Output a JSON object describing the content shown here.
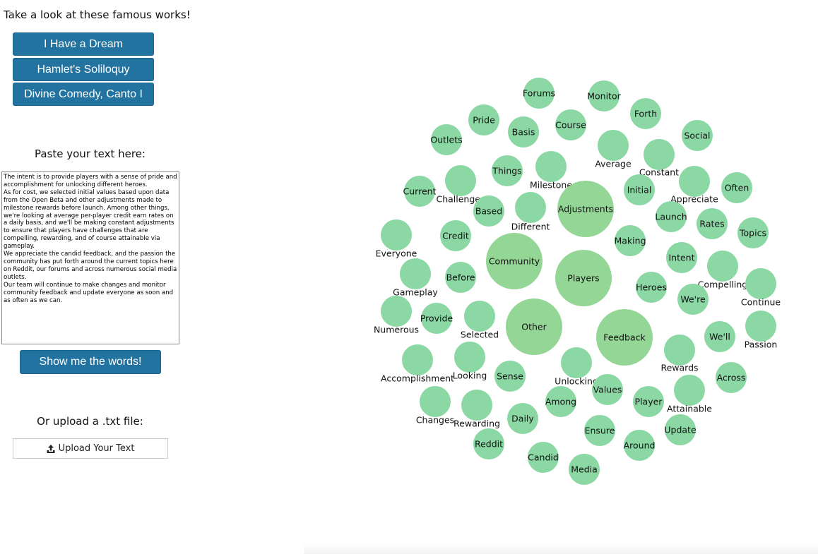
{
  "header": {
    "title": "Take a look at these famous works!"
  },
  "works": [
    {
      "label": "I Have a Dream"
    },
    {
      "label": "Hamlet's Soliloquy"
    },
    {
      "label": "Divine Comedy, Canto I"
    }
  ],
  "paste": {
    "label": "Paste your text here:",
    "text": "The intent is to provide players with a sense of pride and accomplishment for unlocking different heroes.\nAs for cost, we selected initial values based upon data from the Open Beta and other adjustments made to milestone rewards before launch. Among other things, we're looking at average per-player credit earn rates on a daily basis, and we'll be making constant adjustments to ensure that players have challenges that are compelling, rewarding, and of course attainable via gameplay.\nWe appreciate the candid feedback, and the passion the community has put forth around the current topics here on Reddit, our forums and across numerous social media outlets.\nOur team will continue to make changes and monitor community feedback and update everyone as soon and as often as we can."
  },
  "show_button": {
    "label": "Show me the words!"
  },
  "upload": {
    "label": "Or upload a .txt file:",
    "button_label": "Upload Your Text",
    "icon": "upload-icon"
  },
  "colors": {
    "button": "#22739f",
    "bubble": "#8bd8a4",
    "bubble_large": "#94d695"
  },
  "bubbles": [
    {
      "word": "Forums"
    },
    {
      "word": "Monitor"
    },
    {
      "word": "Forth"
    },
    {
      "word": "Pride"
    },
    {
      "word": "Course"
    },
    {
      "word": "Basis"
    },
    {
      "word": "Outlets"
    },
    {
      "word": "Social"
    },
    {
      "word": "Average"
    },
    {
      "word": "Constant"
    },
    {
      "word": "Things"
    },
    {
      "word": "Milestone"
    },
    {
      "word": "Current"
    },
    {
      "word": "Challenges"
    },
    {
      "word": "Initial"
    },
    {
      "word": "Appreciate"
    },
    {
      "word": "Often"
    },
    {
      "word": "Adjustments"
    },
    {
      "word": "Based"
    },
    {
      "word": "Different"
    },
    {
      "word": "Launch"
    },
    {
      "word": "Rates"
    },
    {
      "word": "Topics"
    },
    {
      "word": "Credit"
    },
    {
      "word": "Making"
    },
    {
      "word": "Everyone"
    },
    {
      "word": "Community"
    },
    {
      "word": "Intent"
    },
    {
      "word": "Gameplay"
    },
    {
      "word": "Before"
    },
    {
      "word": "Players"
    },
    {
      "word": "Compelling"
    },
    {
      "word": "Heroes"
    },
    {
      "word": "We're"
    },
    {
      "word": "Continue"
    },
    {
      "word": "Numerous"
    },
    {
      "word": "Provide"
    },
    {
      "word": "Selected"
    },
    {
      "word": "Other"
    },
    {
      "word": "Feedback"
    },
    {
      "word": "We'll"
    },
    {
      "word": "Passion"
    },
    {
      "word": "Rewards"
    },
    {
      "word": "Accomplishment"
    },
    {
      "word": "Looking"
    },
    {
      "word": "Sense"
    },
    {
      "word": "Unlocking"
    },
    {
      "word": "Values"
    },
    {
      "word": "Across"
    },
    {
      "word": "Attainable"
    },
    {
      "word": "Among"
    },
    {
      "word": "Player"
    },
    {
      "word": "Changes"
    },
    {
      "word": "Rewarding"
    },
    {
      "word": "Daily"
    },
    {
      "word": "Ensure"
    },
    {
      "word": "Update"
    },
    {
      "word": "Reddit"
    },
    {
      "word": "Around"
    },
    {
      "word": "Candid"
    },
    {
      "word": "Media"
    }
  ]
}
